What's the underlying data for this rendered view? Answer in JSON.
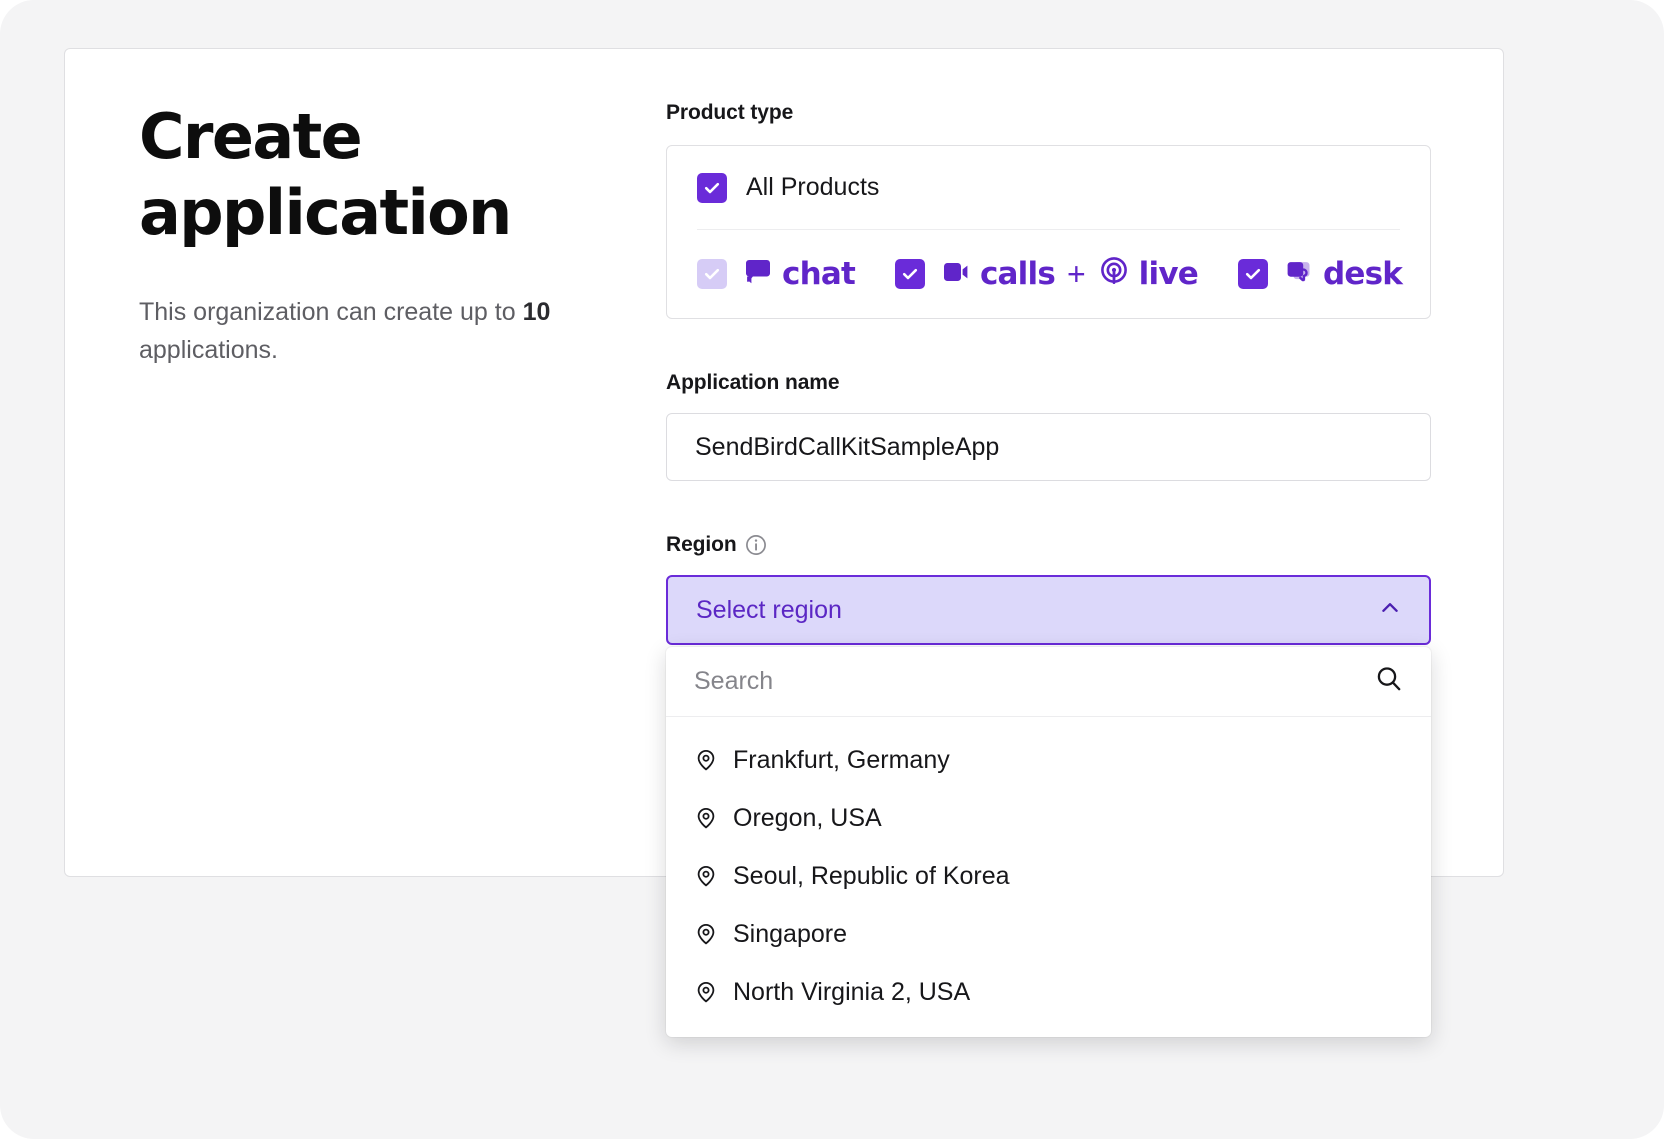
{
  "header": {
    "title_line1": "Create",
    "title_line2": "application",
    "subtitle_before": "This organization can create up to ",
    "subtitle_count": "10",
    "subtitle_after": " applications."
  },
  "product_type": {
    "label": "Product type",
    "all_products": {
      "label": "All Products",
      "checked": true,
      "state": "checked"
    },
    "items": [
      {
        "name": "chat",
        "label": "chat",
        "icon": "chat-bubble-icon",
        "checked": true,
        "state": "disabled-checked"
      },
      {
        "name": "calls",
        "label": "calls",
        "icon": "video-camera-icon",
        "checked": true,
        "state": "checked"
      },
      {
        "name": "live",
        "label": "live",
        "icon": "broadcast-icon",
        "checked": true,
        "state": "checked"
      },
      {
        "name": "desk",
        "label": "desk",
        "icon": "stacked-bubbles-icon",
        "checked": true,
        "state": "checked"
      }
    ],
    "separator": "+"
  },
  "application_name": {
    "label": "Application name",
    "value": "SendBirdCallKitSampleApp",
    "placeholder": "Application name"
  },
  "region": {
    "label": "Region",
    "info_icon": "info-circle-icon",
    "select_value": "Select region",
    "chevron": "chevron-up-icon",
    "expanded": true,
    "search": {
      "placeholder": "Search",
      "value": "",
      "icon": "search-icon"
    },
    "options": [
      {
        "label": "Frankfurt, Germany",
        "icon": "map-pin-icon"
      },
      {
        "label": "Oregon, USA",
        "icon": "map-pin-icon"
      },
      {
        "label": "Seoul, Republic of Korea",
        "icon": "map-pin-icon"
      },
      {
        "label": "Singapore",
        "icon": "map-pin-icon"
      },
      {
        "label": "North Virginia 2, USA",
        "icon": "map-pin-icon"
      }
    ]
  },
  "colors": {
    "brand_purple": "#6025c9",
    "checkbox_purple": "#6a2bd9",
    "checkbox_muted": "#d6ccf6",
    "select_fill": "#dcd8fa",
    "page_bg": "#f4f4f5",
    "card_bg": "#ffffff",
    "text_primary": "#17171a",
    "text_muted": "#5e5e63"
  }
}
